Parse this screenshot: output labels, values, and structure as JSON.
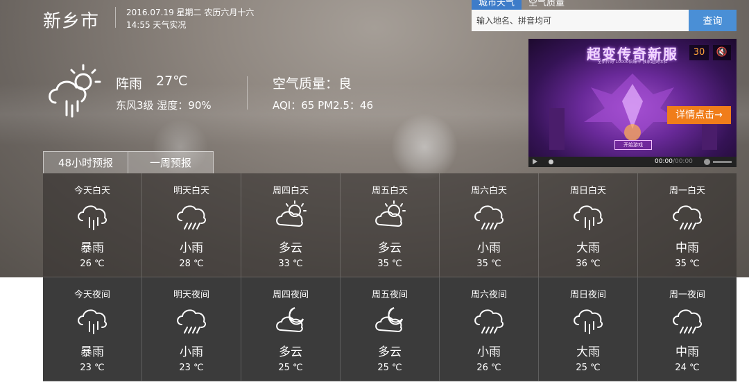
{
  "header": {
    "city": "新乡市",
    "date_line": "2016.07.19 星期二 农历六月十六",
    "time_line": "14:55 天气实况"
  },
  "search": {
    "tabs": [
      "城市天气",
      "空气质量"
    ],
    "placeholder": "输入地名、拼音均可",
    "button": "查询"
  },
  "current": {
    "icon": "shower-rain-sun-icon",
    "condition": "阵雨",
    "temperature": "27℃",
    "wind_humidity": "东风3级   湿度：90%",
    "aq_title": "空气质量：良",
    "aq_values": "AQI：65   PM2.5：46"
  },
  "ad": {
    "title": "超变传奇新服",
    "subtitle": "全新传奇 10000倍爆率 独家超爽体验",
    "countdown": "30",
    "mute": "🔇",
    "cta": "详情点击→",
    "inner_button": "开始游戏",
    "time_current": "00:00",
    "time_total": "/00:00",
    "progress": 0.0
  },
  "forecast": {
    "tabs": [
      "48小时预报",
      "一周预报"
    ],
    "day": [
      {
        "label": "今天白天",
        "cond": "暴雨",
        "temp": "26 ℃",
        "icon": "rain-icon"
      },
      {
        "label": "明天白天",
        "cond": "小雨",
        "temp": "28 ℃",
        "icon": "light-rain-icon"
      },
      {
        "label": "周四白天",
        "cond": "多云",
        "temp": "33 ℃",
        "icon": "cloudy-sun-icon"
      },
      {
        "label": "周五白天",
        "cond": "多云",
        "temp": "35 ℃",
        "icon": "cloudy-sun-icon"
      },
      {
        "label": "周六白天",
        "cond": "小雨",
        "temp": "35 ℃",
        "icon": "light-rain-icon"
      },
      {
        "label": "周日白天",
        "cond": "大雨",
        "temp": "36 ℃",
        "icon": "rain-icon"
      },
      {
        "label": "周一白天",
        "cond": "中雨",
        "temp": "35 ℃",
        "icon": "light-rain-icon"
      }
    ],
    "night": [
      {
        "label": "今天夜间",
        "cond": "暴雨",
        "temp": "23 ℃",
        "icon": "rain-icon"
      },
      {
        "label": "明天夜间",
        "cond": "小雨",
        "temp": "23 ℃",
        "icon": "light-rain-icon"
      },
      {
        "label": "周四夜间",
        "cond": "多云",
        "temp": "25 ℃",
        "icon": "cloudy-moon-icon"
      },
      {
        "label": "周五夜间",
        "cond": "多云",
        "temp": "25 ℃",
        "icon": "cloudy-moon-icon"
      },
      {
        "label": "周六夜间",
        "cond": "小雨",
        "temp": "26 ℃",
        "icon": "light-rain-icon"
      },
      {
        "label": "周日夜间",
        "cond": "大雨",
        "temp": "25 ℃",
        "icon": "rain-icon"
      },
      {
        "label": "周一夜间",
        "cond": "中雨",
        "temp": "24 ℃",
        "icon": "light-rain-icon"
      }
    ]
  },
  "colors": {
    "accent_blue": "#4a8fd6",
    "tab_blue": "#3d7cc9",
    "ad_orange": "#f07d1a",
    "night_bg": "#3b3b3b"
  }
}
